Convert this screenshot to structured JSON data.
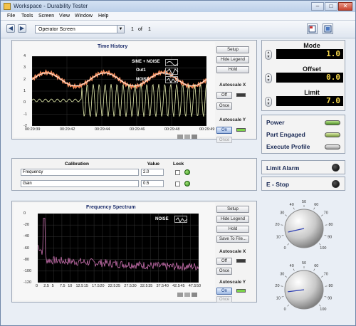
{
  "window": {
    "title": "Workspace - Durability Tester"
  },
  "menu": {
    "items": [
      "File",
      "Tools",
      "Screen",
      "View",
      "Window",
      "Help"
    ]
  },
  "toolbar": {
    "screen_value": "Operator Screen",
    "page_current": "1",
    "page_of": "of",
    "page_total": "1"
  },
  "time_history": {
    "title": "Time History",
    "buttons": {
      "setup": "Setup",
      "hide_legend": "Hide Legend",
      "hold": "Hold"
    },
    "autoscale_x": {
      "label": "Autoscale X",
      "toggle": "Off",
      "once": "Once"
    },
    "autoscale_y": {
      "label": "Autoscale Y",
      "toggle": "On",
      "once": "Once"
    },
    "legend": [
      "SINE + NOISE",
      "Out1",
      "NOISE"
    ]
  },
  "frequency_spectrum": {
    "title": "Frequency Spectrum",
    "buttons": {
      "setup": "Setup",
      "hide_legend": "Hide Legend",
      "hold": "Hold",
      "save": "Save To File..."
    },
    "autoscale_x": {
      "label": "Autoscale X",
      "toggle": "Off",
      "once": "Once"
    },
    "autoscale_y": {
      "label": "Autoscale Y",
      "toggle": "On",
      "once": "Once"
    },
    "legend": [
      "NOISE"
    ]
  },
  "calibration": {
    "headers": {
      "name": "Calibration",
      "value": "Value",
      "lock": "Lock"
    },
    "rows": [
      {
        "name": "Frequency",
        "value": "2.0"
      },
      {
        "name": "Gain",
        "value": "0.5"
      }
    ]
  },
  "controls": {
    "mode": {
      "label": "Mode",
      "value": "1.0"
    },
    "offset": {
      "label": "Offset",
      "value": "0.0"
    },
    "limit": {
      "label": "Limit",
      "value": "7.0"
    }
  },
  "indicators": {
    "power": "Power",
    "part_engaged": "Part Engaged",
    "execute_profile": "Execute Profile",
    "limit_alarm": "Limit Alarm",
    "e_stop": "E - Stop"
  },
  "knobs": {
    "ticks": [
      "0",
      "10",
      "20",
      "30",
      "40",
      "50",
      "60",
      "70",
      "80",
      "90",
      "100"
    ],
    "knob1_value": 12,
    "knob2_value": 14
  },
  "chart_data": [
    {
      "type": "line",
      "title": "Time History",
      "ylim": [
        -2,
        4
      ],
      "y_ticks": [
        "4",
        "3",
        "2",
        "1",
        "0",
        "-1",
        "-2"
      ],
      "x_ticks": [
        "00:29:39",
        "00:29:42",
        "00:29:44",
        "00:29:46",
        "00:29:48",
        "00:29:49"
      ],
      "series": [
        {
          "name": "SINE + NOISE",
          "color": "#f08a5a"
        },
        {
          "name": "Out1",
          "color": "#ffffff"
        },
        {
          "name": "NOISE",
          "color": "#e8f0b0"
        }
      ]
    },
    {
      "type": "line",
      "title": "Frequency Spectrum",
      "ylim": [
        -120,
        0
      ],
      "y_ticks": [
        "0",
        "-20",
        "-40",
        "-60",
        "-80",
        "-100",
        "-120"
      ],
      "x_ticks": [
        "0",
        "2.5",
        "5",
        "7.5",
        "10",
        "12.5",
        "15",
        "17.5",
        "20",
        "22.5",
        "25",
        "27.5",
        "30",
        "32.5",
        "35",
        "37.5",
        "40",
        "42.5",
        "45",
        "47.5",
        "50"
      ],
      "series": [
        {
          "name": "NOISE",
          "color": "#c86fae"
        }
      ]
    }
  ]
}
